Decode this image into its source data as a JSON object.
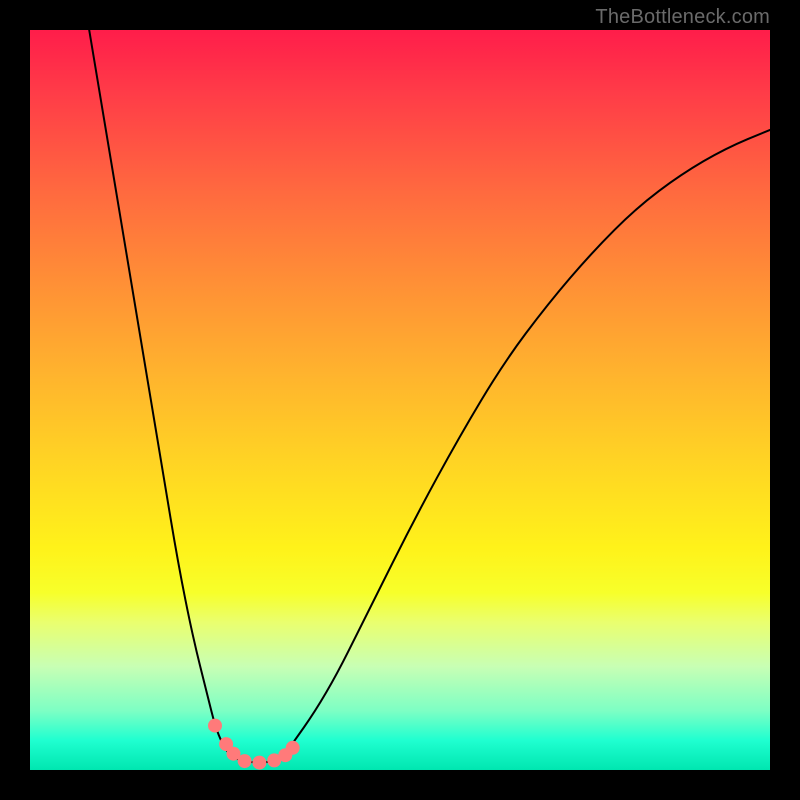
{
  "watermark": "TheBottleneck.com",
  "colors": {
    "frame": "#000000",
    "watermark_text": "#6a6a6a",
    "curve": "#000000",
    "dot": "#ff7a7a"
  },
  "chart_data": {
    "type": "line",
    "title": "",
    "xlabel": "",
    "ylabel": "",
    "xlim": [
      0,
      100
    ],
    "ylim": [
      0,
      100
    ],
    "grid": false,
    "legend": false,
    "series": [
      {
        "name": "left-branch",
        "x": [
          8,
          10,
          12,
          14,
          16,
          18,
          20,
          22,
          24,
          25,
          26,
          27,
          28
        ],
        "y": [
          100,
          88,
          76,
          64,
          52,
          40,
          28,
          18,
          10,
          6,
          3.5,
          2,
          1.5
        ]
      },
      {
        "name": "valley",
        "x": [
          28,
          30,
          32,
          34
        ],
        "y": [
          1.5,
          1,
          1,
          1.5
        ]
      },
      {
        "name": "right-branch",
        "x": [
          34,
          40,
          46,
          52,
          58,
          64,
          70,
          76,
          82,
          88,
          94,
          100
        ],
        "y": [
          1.5,
          10,
          22,
          34,
          45,
          55,
          63,
          70,
          76,
          80.5,
          84,
          86.5
        ]
      }
    ],
    "markers": [
      {
        "x": 25.0,
        "y": 6.0
      },
      {
        "x": 26.5,
        "y": 3.5
      },
      {
        "x": 27.5,
        "y": 2.2
      },
      {
        "x": 29.0,
        "y": 1.2
      },
      {
        "x": 31.0,
        "y": 1.0
      },
      {
        "x": 33.0,
        "y": 1.3
      },
      {
        "x": 34.5,
        "y": 2.0
      },
      {
        "x": 35.5,
        "y": 3.0
      }
    ],
    "gradient_stops": [
      {
        "pos": 0,
        "color": "#ff1d4a"
      },
      {
        "pos": 22,
        "color": "#ff6a3f"
      },
      {
        "pos": 46,
        "color": "#ffb22e"
      },
      {
        "pos": 70,
        "color": "#fff21a"
      },
      {
        "pos": 86,
        "color": "#c8ffb4"
      },
      {
        "pos": 100,
        "color": "#00e6b0"
      }
    ]
  }
}
